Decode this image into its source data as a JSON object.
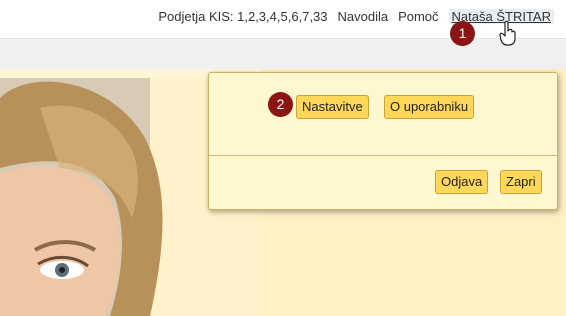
{
  "header": {
    "sites": "Podjetja KIS: 1,2,3,4,5,6,7,33",
    "help_link": "Navodila",
    "support_link": "Pomoč",
    "user_link": "Nataša ŠTRITAR"
  },
  "markers": {
    "step1": "1",
    "step2": "2"
  },
  "popup": {
    "settings_button": "Nastavitve",
    "about_user_button": "O uporabniku",
    "logout_button": "Odjava",
    "close_button": "Zapri"
  },
  "colors": {
    "accent_button": "#ffd85a",
    "popup_bg": "#fff7d0",
    "marker": "#8b1414"
  }
}
